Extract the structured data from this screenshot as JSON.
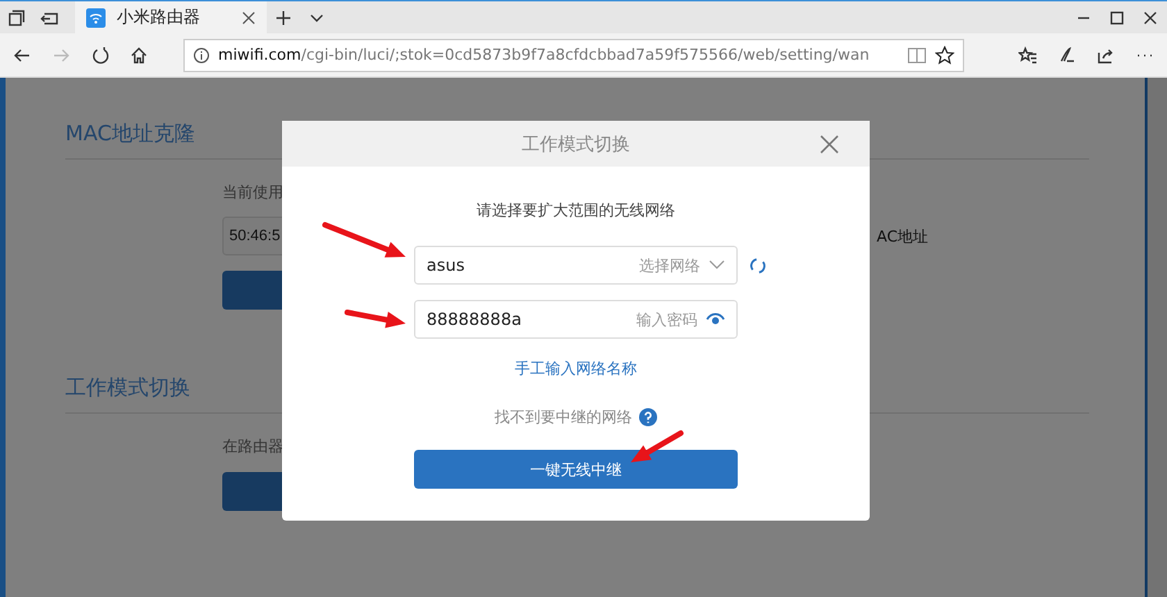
{
  "browser": {
    "tab": {
      "title": "小米路由器"
    },
    "address": {
      "host": "miwifi.com",
      "path": "/cgi-bin/luci/;stok=0cd5873b9f7a8cfdcbbad7a59f575566/web/setting/wan"
    }
  },
  "page": {
    "sections": [
      {
        "title": "MAC地址克隆",
        "note": "当前使用",
        "field": "50:46:5",
        "side_note": "AC地址"
      },
      {
        "title": "工作模式切换",
        "note": "在路由器"
      }
    ]
  },
  "modal": {
    "title": "工作模式切换",
    "prompt": "请选择要扩大范围的无线网络",
    "network": {
      "value": "asus",
      "hint": "选择网络"
    },
    "password": {
      "value": "88888888a",
      "hint": "输入密码"
    },
    "manual_link": "手工输入网络名称",
    "help": "找不到要中继的网络",
    "submit": "一键无线中继"
  }
}
